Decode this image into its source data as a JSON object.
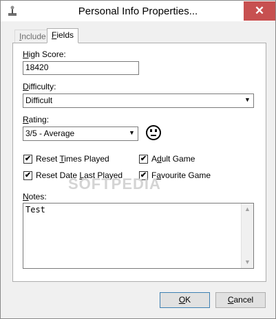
{
  "window": {
    "title": "Personal Info Properties...",
    "close_glyph": "✕"
  },
  "tabs": [
    {
      "label_pre": "",
      "label_key": "I",
      "label_post": "nclude"
    },
    {
      "label_pre": "",
      "label_key": "F",
      "label_post": "ields"
    }
  ],
  "high_score": {
    "label_key": "H",
    "label_post": "igh Score:",
    "value": "18420"
  },
  "difficulty": {
    "label_key": "D",
    "label_post": "ifficulty:",
    "value": "Difficult"
  },
  "rating": {
    "label_key": "R",
    "label_post": "ating:",
    "value": "3/5 - Average",
    "face_icon": "neutral-face-icon"
  },
  "checkboxes": {
    "reset_times_played": {
      "label_pre": "Reset ",
      "label_key": "T",
      "label_post": "imes Played",
      "checked": true
    },
    "reset_date_last_played": {
      "label_pre": "Reset Date ",
      "label_key": "L",
      "label_post": "ast Played",
      "checked": true
    },
    "adult_game": {
      "label_pre": "A",
      "label_key": "d",
      "label_post": "ult Game",
      "checked": true
    },
    "favourite_game": {
      "label_pre": "F",
      "label_key": "a",
      "label_post": "vourite Game",
      "checked": true
    }
  },
  "notes": {
    "label_key": "N",
    "label_post": "otes:",
    "value": "Test"
  },
  "buttons": {
    "ok": {
      "label_key": "O",
      "label_post": "K"
    },
    "cancel": {
      "label_key": "C",
      "label_post": "ancel"
    }
  },
  "watermark": "SOFTPEDIA",
  "check_glyph": "✔"
}
